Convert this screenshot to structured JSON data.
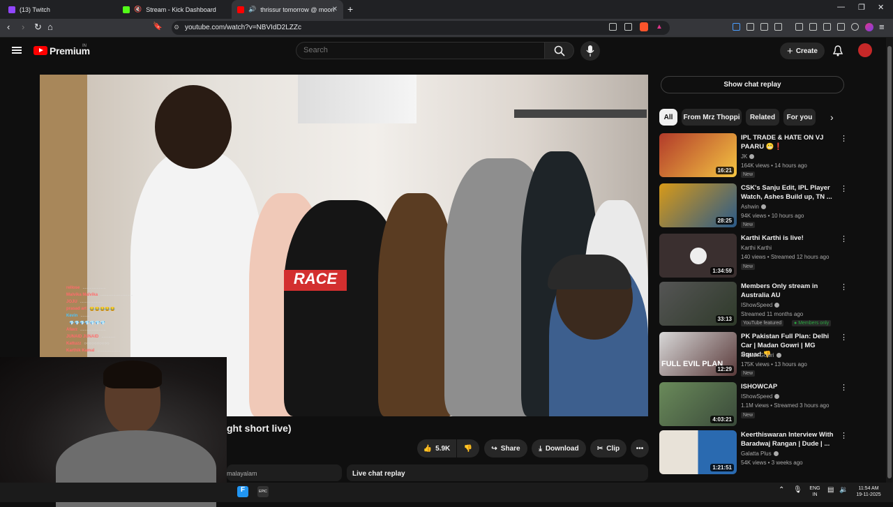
{
  "browser": {
    "tabs": [
      {
        "title": "(13) Twitch",
        "color": "#9146ff"
      },
      {
        "title": "Stream - Kick Dashboard",
        "color": "#53fc18"
      },
      {
        "title": "thrissur tomorrow @ moonnu",
        "color": "#ff0000",
        "active": true
      }
    ],
    "url": "youtube.com/watch?v=NBVIdD2LZZc"
  },
  "masthead": {
    "brand": "Premium",
    "region": "IN",
    "search_placeholder": "Search",
    "create_label": "Create"
  },
  "video": {
    "title_visible": "ght short live)",
    "likes": "5.9K",
    "share": "Share",
    "download": "Download",
    "clip": "Clip",
    "channel_strip": "malayalam",
    "live_chat": "Live chat replay",
    "chat_overlay": [
      {
        "name": "rellose",
        "msg": "....................",
        "blue": false
      },
      {
        "name": "Malvika Malvika",
        "msg": "............................",
        "blue": false
      },
      {
        "name": "JOJU",
        "msg": "....................",
        "blue": false
      },
      {
        "name": "prasad art",
        "msg": "😂😂😂😂😂",
        "blue": false
      },
      {
        "name": "Kevin",
        "msg": "........",
        "blue": true
      },
      {
        "name": "",
        "msg": "💎💎💎💎💎💎💎",
        "blue": false
      },
      {
        "name": "Afavz",
        "msg": "......................",
        "blue": false
      },
      {
        "name": "JUNAID JUNAID",
        "msg": "............",
        "blue": false
      },
      {
        "name": "Kattuzz",
        "msg": "○○○○○○○○○○",
        "blue": false
      },
      {
        "name": "Karthik Kamal",
        "msg": "....................",
        "blue": false
      }
    ]
  },
  "sidebar": {
    "replay_button": "Show chat replay",
    "chips": [
      "All",
      "From Mrz Thoppi",
      "Related",
      "For you"
    ],
    "recs": [
      {
        "title": "IPL TRADE & HATE ON VJ PAARU 😬❗",
        "channel": "JK",
        "meta": "164K views • 14 hours ago",
        "badge": "New",
        "duration": "16:21",
        "thumb": "#b23a2a"
      },
      {
        "title": "CSK's Sanju Edit, IPL Player Watch, Ashes Build up, TN ...",
        "channel": "Ashwin",
        "meta": "94K views • 10 hours ago",
        "badge": "New",
        "duration": "28:25",
        "thumb": "#d89a18"
      },
      {
        "title": "Karthi Karthi is live!",
        "channel": "Karthi Karthi",
        "meta": "140 views • Streamed 12 hours ago",
        "badge": "New",
        "duration": "1:34:59",
        "thumb": "#3a2f2f"
      },
      {
        "title": "Members Only stream in Australia AU",
        "channel": "IShowSpeed",
        "meta": "Streamed 11 months ago",
        "badge": "YouTube featured",
        "badge2": "Members only",
        "duration": "33:13",
        "thumb": "#2f3a2a"
      },
      {
        "title": "PK Pakistan Full Plan: Delhi Car | Madan Gowri | MG Squad 👎",
        "channel": "Madan Gowri",
        "meta": "175K views • 13 hours ago",
        "badge": "New",
        "duration": "12:29",
        "thumb": "#5a3a3a"
      },
      {
        "title": "ISHOWCAP",
        "channel": "IShowSpeed",
        "meta": "1.1M views • Streamed 3 hours ago",
        "badge": "New",
        "duration": "4:03:21",
        "thumb": "#3a4a3a"
      },
      {
        "title": "Keerthiswaran Interview With Baradwaj Rangan | Dude | ...",
        "channel": "Galatta Plus",
        "meta": "54K views • 3 weeks ago",
        "badge": "",
        "duration": "1:21:51",
        "thumb": "#c8c2b8"
      }
    ]
  },
  "taskbar": {
    "lang": "ENG",
    "region": "IN",
    "time": "11:54 AM",
    "date": "19-11-2025"
  }
}
